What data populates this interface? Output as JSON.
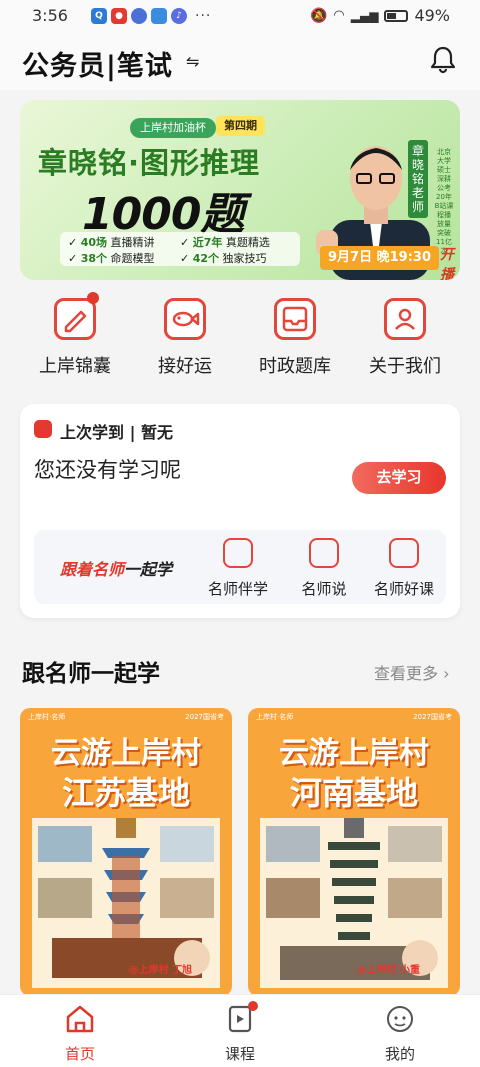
{
  "status": {
    "time": "3:56",
    "battery": "49%",
    "signal": "4G"
  },
  "header": {
    "title": "公务员|笔试",
    "switch_icon": "swap-icon",
    "bell_icon": "bell-icon"
  },
  "banner": {
    "tag": "上岸村加油杯",
    "period": "第四期",
    "title": "章晓铭·图形推理",
    "big": "1000题",
    "features": [
      {
        "num": "40场",
        "text": "直播精讲"
      },
      {
        "num": "近7年",
        "text": "真题精选"
      },
      {
        "num": "38个",
        "text": "命题模型"
      },
      {
        "num": "42个",
        "text": "独家技巧"
      }
    ],
    "teacher": "章晓铭老师",
    "teacher_desc": "北京大学硕士 深耕公考20年 B站课程播放量突破11亿次",
    "date": "9月7日 晚19:30",
    "start": "开播"
  },
  "quicknav": [
    {
      "label": "上岸锦囊",
      "icon": "pencil-note-icon",
      "badge": true
    },
    {
      "label": "接好运",
      "icon": "fish-icon",
      "badge": false
    },
    {
      "label": "时政题库",
      "icon": "inbox-icon",
      "badge": false
    },
    {
      "label": "关于我们",
      "icon": "person-icon",
      "badge": false
    }
  ],
  "study": {
    "last_label": "上次学到 | 暂无",
    "empty": "您还没有学习呢",
    "button": "去学习",
    "follow_title_red": "跟着名师",
    "follow_title_black": "一起学",
    "items": [
      {
        "label": "名师伴学",
        "icon": "graduation-cap-icon"
      },
      {
        "label": "名师说",
        "icon": "video-frame-icon"
      },
      {
        "label": "名师好课",
        "icon": "play-stack-icon"
      }
    ]
  },
  "section": {
    "title": "跟名师一起学",
    "more": "查看更多"
  },
  "posters": [
    {
      "line1": "云游上岸村",
      "line2": "江苏基地",
      "top_left": "上岸村·名师",
      "top_right": "2027国省考",
      "name": "@上岸村 丁旭"
    },
    {
      "line1": "云游上岸村",
      "line2": "河南基地",
      "top_left": "上岸村·名师",
      "top_right": "2027国省考",
      "name": "@上岸村 小重"
    }
  ],
  "tabs": [
    {
      "label": "首页",
      "icon": "home-icon",
      "active": true
    },
    {
      "label": "课程",
      "icon": "course-icon",
      "active": false,
      "badge": true
    },
    {
      "label": "我的",
      "icon": "profile-avatar-icon",
      "active": false
    }
  ],
  "colors": {
    "accent": "#e2382c",
    "banner_green": "#2a7d23",
    "poster_orange": "#f8a63c"
  }
}
